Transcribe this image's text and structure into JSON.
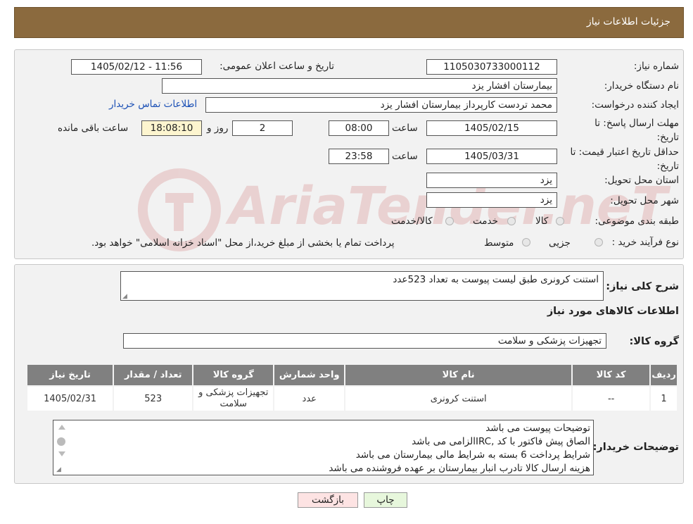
{
  "header": {
    "title": "جزئیات اطلاعات نیاز"
  },
  "form": {
    "need_number_label": "شماره نیاز:",
    "need_number": "1105030733000112",
    "announce_label": "تاریخ و ساعت اعلان عمومی:",
    "announce_value": "1405/02/12 - 11:56",
    "buyer_name_label": "نام دستگاه خریدار:",
    "buyer_name": "بیمارستان افشار یزد",
    "creator_label": "ایجاد کننده درخواست:",
    "creator": "محمد تردست کارپرداز بیمارستان افشار یزد",
    "contact_link": "اطلاعات تماس خریدار",
    "deadline_label": "مهلت ارسال پاسخ: تا تاریخ:",
    "deadline_date": "1405/02/15",
    "time_label": "ساعت",
    "deadline_time": "08:00",
    "days_value": "2",
    "days_label": "روز و",
    "remaining_value": "18:08:10",
    "remaining_label": "ساعت باقی مانده",
    "validity_label": "حداقل تاریخ اعتبار قیمت: تا تاریخ:",
    "validity_date": "1405/03/31",
    "validity_time": "23:58",
    "province_label": "استان محل تحویل:",
    "province": "یزد",
    "city_label": "شهر محل تحویل:",
    "city": "یزد",
    "category_label": "طبقه بندی موضوعی:",
    "category_options": [
      "کالا",
      "خدمت",
      "کالا/خدمت"
    ],
    "process_label": "نوع فرآیند خرید :",
    "process_options": [
      "جزیی",
      "متوسط"
    ],
    "process_note": "پرداخت تمام یا بخشی از مبلغ خرید،از محل \"اسناد خزانه اسلامی\" خواهد بود."
  },
  "summary": {
    "desc_label": "شرح کلی نیاز:",
    "desc_value": "استنت کرونری طبق لیست پیوست به تعداد 523عدد",
    "goods_info_title": "اطلاعات کالاهای مورد نیاز",
    "group_label": "گروه کالا:",
    "group_value": "تجهیزات پزشکی و سلامت"
  },
  "table": {
    "headers": [
      "ردیف",
      "کد کالا",
      "نام کالا",
      "واحد شمارش",
      "گروه کالا",
      "تعداد / مقدار",
      "تاریخ نیاز"
    ],
    "rows": [
      [
        "1",
        "--",
        "استنت کرونری",
        "عدد",
        "تجهیزات پزشکی و سلامت",
        "523",
        "1405/02/31"
      ]
    ]
  },
  "buyer_notes": {
    "label": "توضیحات خریدار:",
    "lines": [
      "توضیحات پیوست می باشد",
      "الصاق پیش فاکتور با کد  ,IRCالزامی می باشد",
      "شرایط پرداخت  6 بسته به شرایط مالی بیمارستان می باشد",
      "هزینه ارسال کالا تادرب انبار بیمارستان بر عهده فروشنده می باشد"
    ]
  },
  "buttons": {
    "back": "بازگشت",
    "print": "چاپ"
  },
  "watermark": {
    "text": "AriaTender.neT"
  },
  "colors": {
    "header_bg": "#8b6a3e",
    "table_header_bg": "#808080",
    "remaining_bg": "#fdf5cf",
    "back_btn_bg": "#fde3e3",
    "print_btn_bg": "#e7f7dc",
    "link": "#1a4fb5"
  }
}
